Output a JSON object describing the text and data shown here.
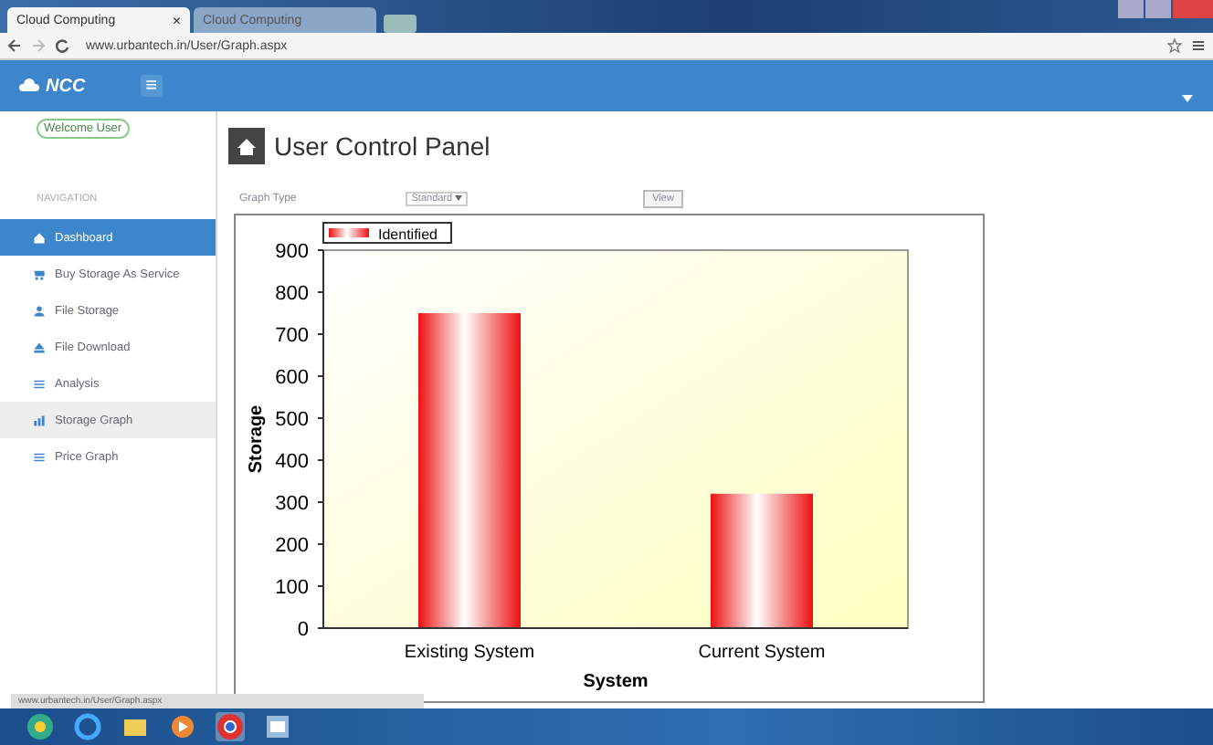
{
  "browser": {
    "tabs": [
      {
        "label": "Cloud Computing",
        "selected": true
      },
      {
        "label": "Cloud Computing",
        "selected": false
      }
    ],
    "close_glyph": "×",
    "address": "www.urbantech.in/User/Graph.aspx"
  },
  "header": {
    "logo": "NCC",
    "menu_glyph": "≡"
  },
  "welcome": "Welcome User",
  "sidebar": {
    "heading": "NAVIGATION",
    "items": [
      {
        "label": "Dashboard",
        "selected": true,
        "hovered": false
      },
      {
        "label": "Buy Storage As Service",
        "selected": false,
        "hovered": false
      },
      {
        "label": "File Storage",
        "selected": false,
        "hovered": false
      },
      {
        "label": "File Download",
        "selected": false,
        "hovered": false
      },
      {
        "label": "Analysis",
        "selected": false,
        "hovered": false
      },
      {
        "label": "Storage Graph",
        "selected": false,
        "hovered": true
      },
      {
        "label": "Price Graph",
        "selected": false,
        "hovered": false
      }
    ]
  },
  "page": {
    "title": "User Control Panel",
    "graph_type_label": "Graph Type",
    "graph_type_value": "Standard",
    "view_button": "View",
    "chart_data": {
      "type": "bar",
      "xlabel": "System",
      "ylabel": "Storage",
      "categories": [
        "Existing System",
        "Current System"
      ],
      "series": [
        {
          "name": "Identified",
          "color": "#ee1111",
          "values": [
            750,
            320
          ]
        }
      ],
      "ylim": [
        0,
        900
      ],
      "yticks": [
        0,
        100,
        200,
        300,
        400,
        500,
        600,
        700,
        800,
        900
      ]
    }
  },
  "status_url": "www.urbantech.in/User/Graph.aspx"
}
